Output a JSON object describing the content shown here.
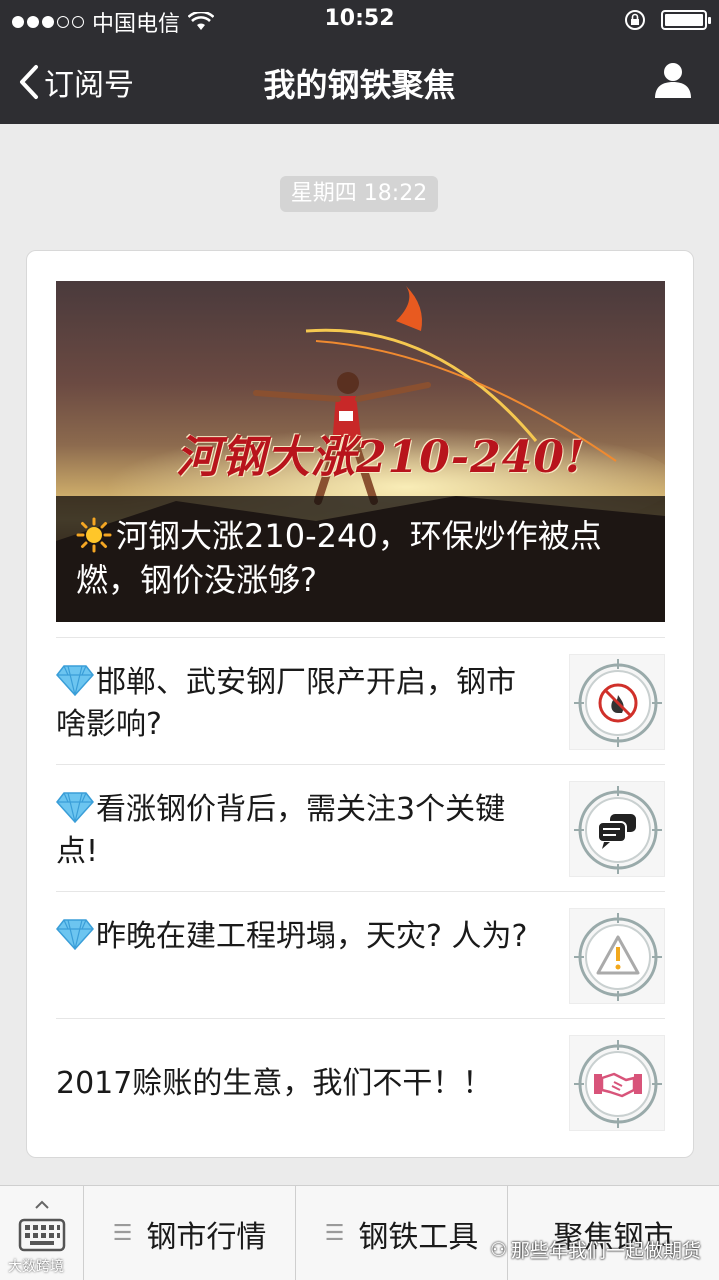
{
  "status_bar": {
    "carrier": "中国电信",
    "time": "10:52"
  },
  "nav": {
    "back_label": "订阅号",
    "title": "我的钢铁聚焦"
  },
  "timestamp": "星期四 18:22",
  "hero": {
    "image_text": "河钢大涨210-240!",
    "title": "河钢大涨210-240，环保炒作被点燃，钢价没涨够?"
  },
  "articles": [
    {
      "title": "邯郸、武安钢厂限产开启，钢市啥影响?",
      "icon": "no-fire-icon"
    },
    {
      "title": "看涨钢价背后，需关注3个关键点!",
      "icon": "chat-bubbles-icon"
    },
    {
      "title": "昨晚在建工程坍塌，天灾? 人为?",
      "icon": "warning-icon"
    },
    {
      "title": "2017赊账的生意，我们不干！！",
      "icon": "handshake-icon"
    }
  ],
  "bottom_menu": {
    "items": [
      "钢市行情",
      "钢铁工具",
      "聚焦钢市"
    ]
  },
  "watermark": {
    "right": "那些年我们一起做期货",
    "left": "大数跨境"
  },
  "colors": {
    "header_bg": "#2e2e32",
    "page_bg": "#ebebeb",
    "overlay_red": "#b8141c"
  }
}
